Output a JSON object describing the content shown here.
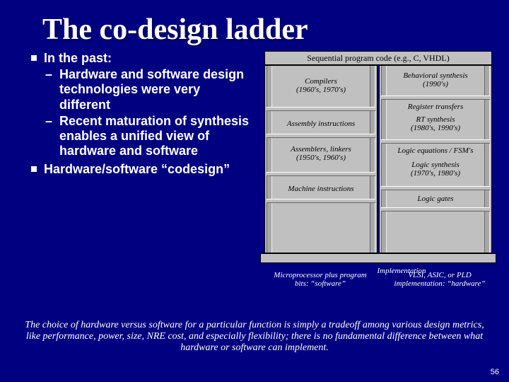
{
  "title": "The co-design ladder",
  "bullets": {
    "items": [
      {
        "text": "In the past:",
        "sub": [
          "Hardware and software design technologies were very different",
          "Recent maturation of synthesis enables a unified view of hardware and software"
        ]
      },
      {
        "text": "Hardware/software “codesign”",
        "sub": []
      }
    ]
  },
  "diagram": {
    "top": "Sequential program code (e.g., C, VHDL)",
    "left": [
      "Compilers\n(1960's, 1970's)",
      "Assembly instructions",
      "Assemblers, linkers\n(1950's, 1960's)",
      "Machine instructions"
    ],
    "right": [
      "Behavioral synthesis\n(1990's)",
      "Register transfers",
      "RT synthesis\n(1980's, 1990's)",
      "Logic equations / FSM's",
      "Logic synthesis\n(1970's, 1980's)",
      "Logic gates"
    ],
    "impl_left": "Microprocessor plus program bits: “software”",
    "impl_mid": "Implementation",
    "impl_right": "VLSI, ASIC, or PLD implementation: “hardware”"
  },
  "footnote": "The choice of hardware versus software for a particular function is simply a tradeoff among various design metrics, like performance, power, size, NRE cost, and especially flexibility; there is no fundamental difference between what hardware or software can implement.",
  "pagenum": "56"
}
